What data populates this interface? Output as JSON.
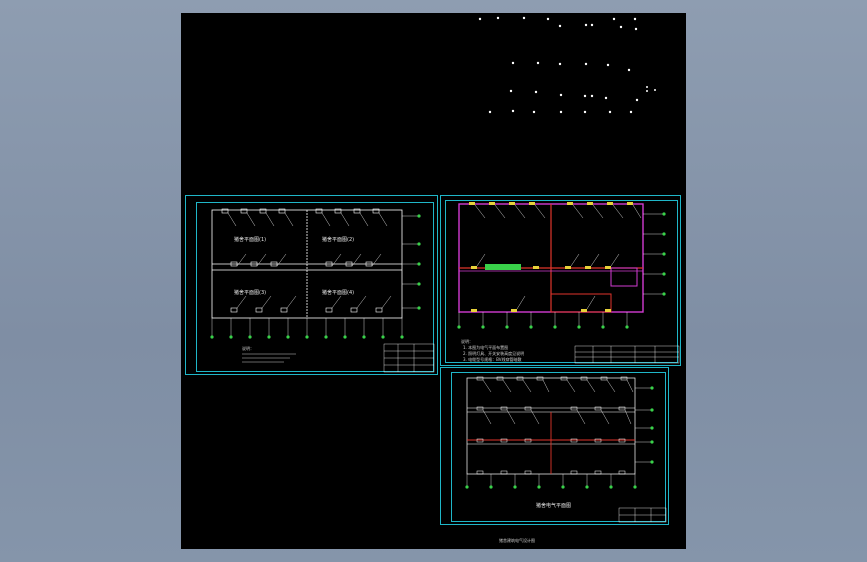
{
  "viewer": {
    "background": "#8595aa",
    "canvas_color": "#000000"
  },
  "accent": {
    "frame": "#1fb6c8",
    "magenta": "#d23bd2",
    "red": "#e0352b",
    "green": "#39d24a",
    "yellow": "#e8d23a"
  },
  "sheet_left": {
    "rooms": [
      "猪舍平面图(1)",
      "猪舍平面图(2)",
      "猪舍平面图(3)",
      "猪舍平面图(4)"
    ],
    "notes_title": "说明："
  },
  "sheet_right_top": {
    "notes": [
      "说明：",
      "1. 本图为电气平面布置图",
      "2. 照明灯具、开关安装高度见说明",
      "3. 电缆型号规格：BV线穿管暗敷"
    ]
  },
  "sheet_right_bottom": {
    "title": "猪舍电气平面图"
  },
  "caption": "猪舍建筑电气设计图"
}
